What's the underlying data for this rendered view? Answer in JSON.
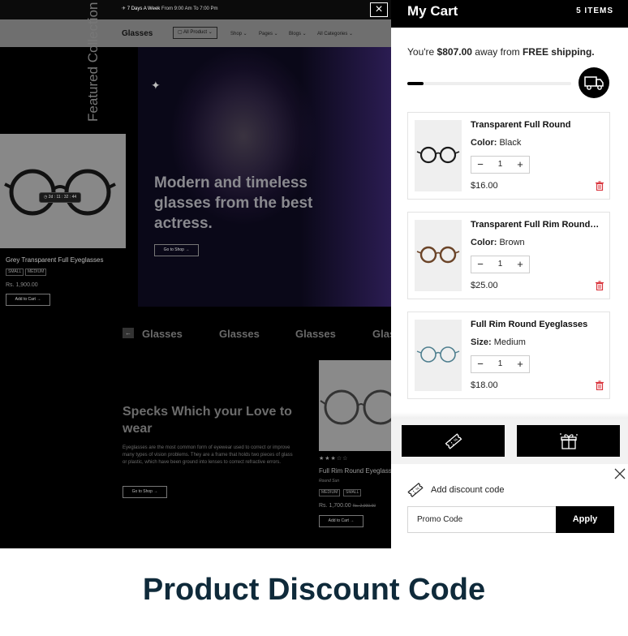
{
  "store": {
    "announcement_main": "7 Days A Week",
    "announcement_hours": "From 9:00 Am To 7:00 Pm",
    "logo": "Glasses",
    "nav": {
      "all_product": "All Product",
      "shop": "Shop",
      "pages": "Pages",
      "blogs": "Blogs",
      "all_categories": "All Categories"
    },
    "hero": {
      "title": "Modern and timeless glasses from the best actress.",
      "button": "Go to Shop"
    },
    "featured": {
      "vertical_title": "Featured Collection",
      "timer": "2d : 11 : 32 : 44",
      "product_name": "Grey Transparent Full Eyeglasses",
      "tags": [
        "SMALL",
        "MEDIUM"
      ],
      "price": "Rs. 1,900.00",
      "button": "Add to Cart"
    },
    "brand_logos": [
      "Glasses",
      "Glasses",
      "Glasses",
      "Glas"
    ],
    "specks": {
      "title": "Specks Which your Love to wear",
      "description": "Eyeglasses are the most common form of eyewear used to correct or improve many types of vision problems. They are a frame that holds two pieces of glass or plastic, which have been ground into lenses to correct refractive errors.",
      "button": "Go to Shop"
    },
    "product2": {
      "stars": "★★★☆☆",
      "rating": 3,
      "name": "Full Rim Round Eyeglasses",
      "subtitle": "Round Sun",
      "tags": [
        "MEDIUM",
        "SMALL"
      ],
      "price": "Rs. 1,700.00",
      "compare_price": "Rs. 2,000.00",
      "button": "Add to Cart"
    }
  },
  "cart": {
    "title": "My Cart",
    "count": "5 ITEMS",
    "shipping": {
      "prefix": "You're ",
      "amount": "$807.00",
      "middle": " away from ",
      "highlight": "FREE shipping.",
      "progress": 0.1
    },
    "items": [
      {
        "name": "Transparent Full Round",
        "attr_label": "Color:",
        "attr_value": " Black",
        "qty": "1",
        "price": "$16.00",
        "frame_color": "#1a1a1a"
      },
      {
        "name": "Transparent Full Rim Round Eyeglasses",
        "attr_label": "Color:",
        "attr_value": " Brown",
        "qty": "1",
        "price": "$25.00",
        "frame_color": "#6b4428"
      },
      {
        "name": "Full Rim Round Eyeglasses",
        "attr_label": "Size:",
        "attr_value": " Medium",
        "qty": "1",
        "price": "$18.00",
        "frame_color": "#4f7f8f"
      }
    ],
    "qty_minus": "−",
    "qty_plus": "+",
    "discount": {
      "label": "Add discount code",
      "placeholder": "Promo Code",
      "apply": "Apply"
    },
    "colors": {
      "accent": "#000000",
      "delete": "#d9363e"
    }
  },
  "caption": "Product Discount Code"
}
